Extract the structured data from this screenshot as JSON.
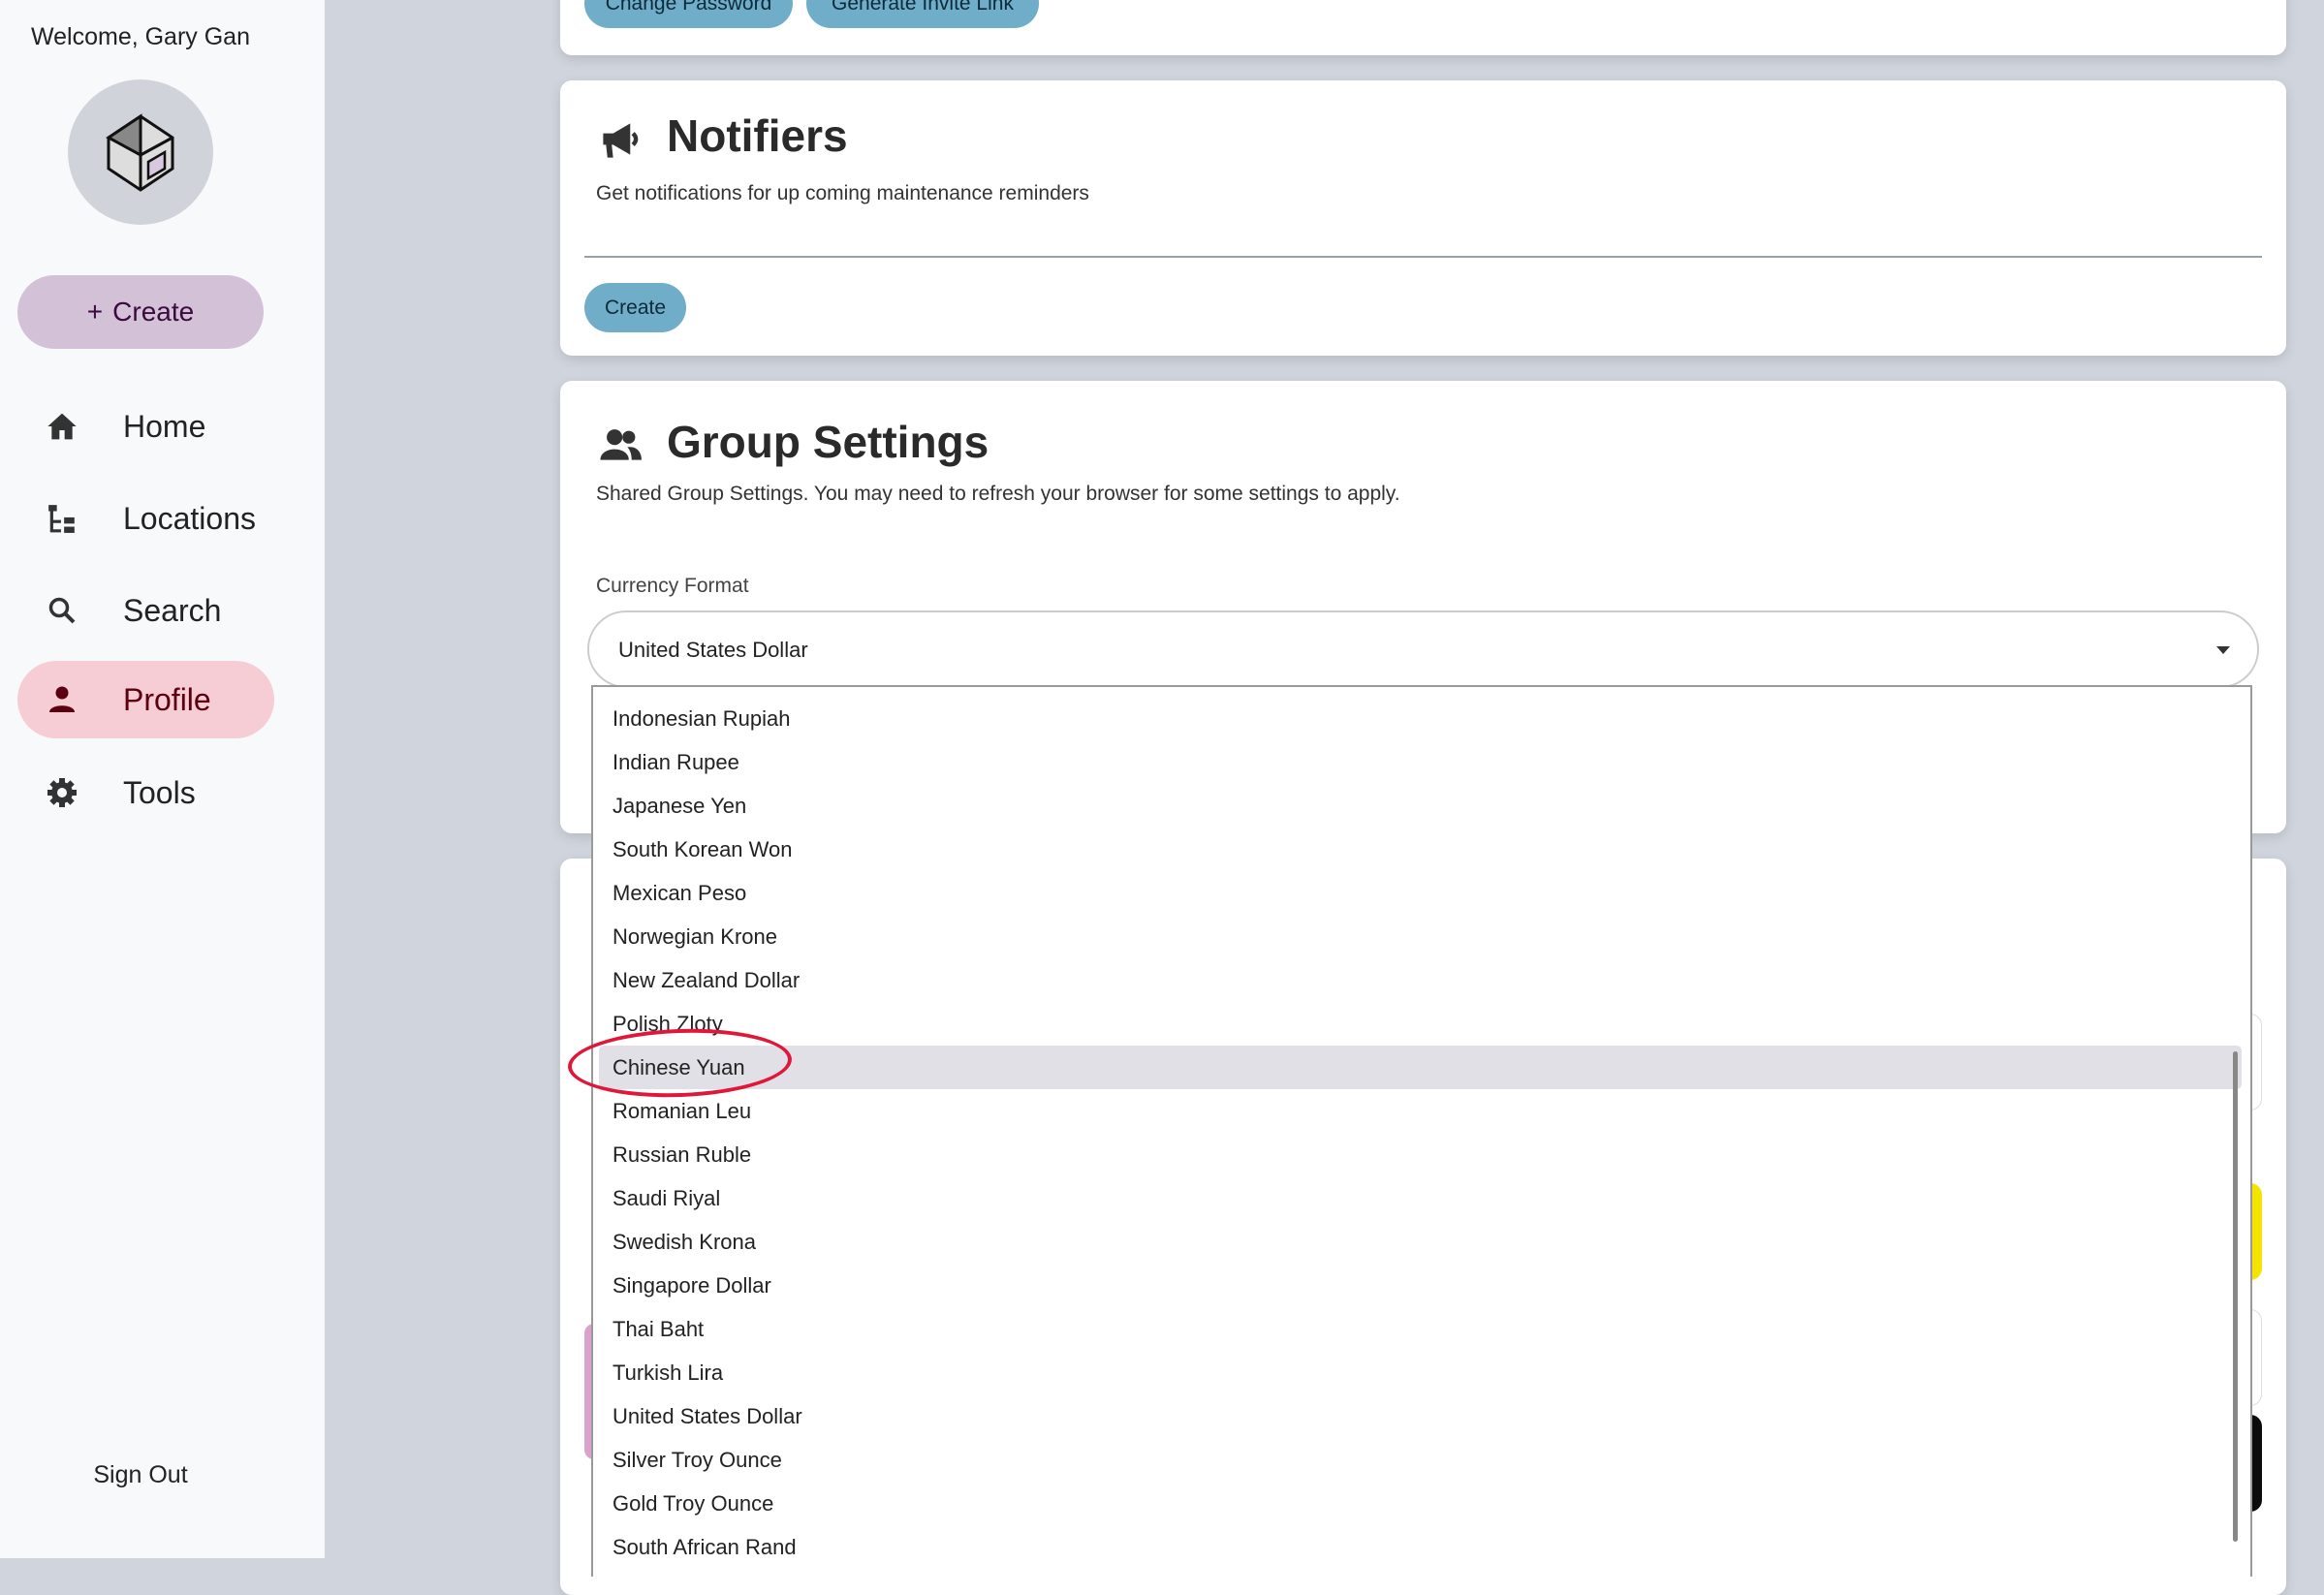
{
  "sidebar": {
    "welcome": "Welcome, Gary Gan",
    "create_label": "Create",
    "items": [
      {
        "label": "Home",
        "icon": "home-icon"
      },
      {
        "label": "Locations",
        "icon": "tree-icon"
      },
      {
        "label": "Search",
        "icon": "search-icon"
      },
      {
        "label": "Profile",
        "icon": "person-icon",
        "active": true
      },
      {
        "label": "Tools",
        "icon": "gear-icon"
      }
    ],
    "sign_out": "Sign Out"
  },
  "account_card": {
    "change_password": "Change Password",
    "generate_invite": "Generate Invite Link"
  },
  "notifiers": {
    "title": "Notifiers",
    "subtitle": "Get notifications for up coming maintenance reminders",
    "create": "Create"
  },
  "group_settings": {
    "title": "Group Settings",
    "subtitle": "Shared Group Settings. You may need to refresh your browser for some settings to apply.",
    "currency_label": "Currency Format",
    "currency_value": "United States Dollar",
    "options": [
      "Indonesian Rupiah",
      "Indian Rupee",
      "Japanese Yen",
      "South Korean Won",
      "Mexican Peso",
      "Norwegian Krone",
      "New Zealand Dollar",
      "Polish Zloty",
      "Chinese Yuan",
      "Romanian Leu",
      "Russian Ruble",
      "Saudi Riyal",
      "Swedish Krona",
      "Singapore Dollar",
      "Thai Baht",
      "Turkish Lira",
      "United States Dollar",
      "Silver Troy Ounce",
      "Gold Troy Ounce",
      "South African Rand"
    ],
    "highlighted_option": "Chinese Yuan"
  },
  "colors": {
    "accent_button": "#6fadc9",
    "active_nav": "#f6cdd4",
    "create_button": "#d3c1d8",
    "annotation": "#e0173a"
  }
}
